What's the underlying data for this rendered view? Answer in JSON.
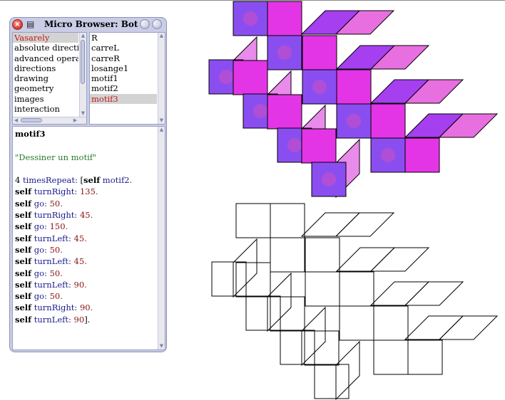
{
  "window": {
    "title": "Micro Browser: Bot",
    "close_glyph": "×",
    "menu_glyph": "▤",
    "collapse_glyph": "◦",
    "expand_glyph": "◦"
  },
  "categories": {
    "items": [
      "Vasarely",
      "absolute directions",
      "advanced operators",
      "directions",
      "drawing",
      "geometry",
      "images",
      "interaction"
    ],
    "selected_index": 0
  },
  "selectors": {
    "items": [
      "R",
      "carreL",
      "carreR",
      "losange1",
      "motif1",
      "motif2",
      "motif3"
    ],
    "selected_index": 6
  },
  "code": {
    "method_name": "motif3",
    "comment": "\"Dessiner un motif\"",
    "lines": [
      [
        [
          "plain",
          "4 "
        ],
        [
          "sel",
          "timesRepeat: "
        ],
        [
          "plain",
          "["
        ],
        [
          "kw",
          "self"
        ],
        [
          "sel",
          " motif2"
        ],
        [
          "num",
          "."
        ]
      ],
      [
        [
          "kw",
          "self"
        ],
        [
          "sel",
          " turnRight: "
        ],
        [
          "num",
          "135."
        ]
      ],
      [
        [
          "kw",
          "self"
        ],
        [
          "sel",
          " go: "
        ],
        [
          "num",
          "50."
        ]
      ],
      [
        [
          "kw",
          "self"
        ],
        [
          "sel",
          " turnRight: "
        ],
        [
          "num",
          "45."
        ]
      ],
      [
        [
          "kw",
          "self"
        ],
        [
          "sel",
          " go: "
        ],
        [
          "num",
          "150."
        ]
      ],
      [
        [
          "kw",
          "self"
        ],
        [
          "sel",
          " turnLeft: "
        ],
        [
          "num",
          "45."
        ]
      ],
      [
        [
          "kw",
          "self"
        ],
        [
          "sel",
          " go: "
        ],
        [
          "num",
          "50."
        ]
      ],
      [
        [
          "kw",
          "self"
        ],
        [
          "sel",
          " turnLeft: "
        ],
        [
          "num",
          "45."
        ]
      ],
      [
        [
          "kw",
          "self"
        ],
        [
          "sel",
          " go: "
        ],
        [
          "num",
          "50."
        ]
      ],
      [
        [
          "kw",
          "self"
        ],
        [
          "sel",
          " turnLeft: "
        ],
        [
          "num",
          "90."
        ]
      ],
      [
        [
          "kw",
          "self"
        ],
        [
          "sel",
          " go: "
        ],
        [
          "num",
          "50."
        ]
      ],
      [
        [
          "kw",
          "self"
        ],
        [
          "sel",
          " turnRight: "
        ],
        [
          "num",
          "90."
        ]
      ],
      [
        [
          "kw",
          "self"
        ],
        [
          "sel",
          " turnLeft: "
        ],
        [
          "num",
          "90"
        ],
        [
          "plain",
          "]."
        ]
      ]
    ]
  },
  "colors": {
    "square_purple": "#8a4ef0",
    "square_purple_dot": "#b14ed6",
    "square_magenta": "#e335e6",
    "parallelogram_light": "#e98bea",
    "parallelogram_violet": "#a53ff0",
    "parallelogram_pink": "#e86fe0",
    "outline": "#000000"
  },
  "icons": [
    "close-icon",
    "window-menu-icon",
    "collapse-icon",
    "expand-icon",
    "scroll-up-icon",
    "scroll-down-icon",
    "scroll-left-icon",
    "scroll-right-icon"
  ]
}
